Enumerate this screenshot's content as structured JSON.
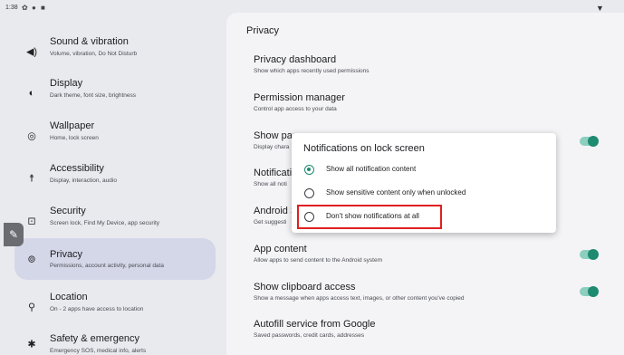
{
  "status_bar": {
    "time": "1:38",
    "icons": [
      "gear-icon",
      "circle-icon",
      "square-icon"
    ],
    "wifi": "wifi-icon"
  },
  "left_nav": {
    "items": [
      {
        "title": "Sound & vibration",
        "subtitle": "Volume, vibration, Do Not Disturb",
        "icon": "speaker-icon"
      },
      {
        "title": "Display",
        "subtitle": "Dark theme, font size, brightness",
        "icon": "brightness-icon"
      },
      {
        "title": "Wallpaper",
        "subtitle": "Home, lock screen",
        "icon": "palette-icon"
      },
      {
        "title": "Accessibility",
        "subtitle": "Display, interaction, audio",
        "icon": "accessibility-icon"
      },
      {
        "title": "Security",
        "subtitle": "Screen lock, Find My Device, app security",
        "icon": "lock-icon"
      },
      {
        "title": "Privacy",
        "subtitle": "Permissions, account activity, personal data",
        "icon": "privacy-icon",
        "selected": true
      },
      {
        "title": "Location",
        "subtitle": "On - 2 apps have access to location",
        "icon": "location-icon"
      },
      {
        "title": "Safety & emergency",
        "subtitle": "Emergency SOS, medical info, alerts",
        "icon": "asterisk-icon"
      }
    ]
  },
  "privacy": {
    "title": "Privacy",
    "settings": [
      {
        "title": "Privacy dashboard",
        "subtitle": "Show which apps recently used permissions"
      },
      {
        "title": "Permission manager",
        "subtitle": "Control app access to your data"
      },
      {
        "title": "Show pas",
        "subtitle": "Display chara",
        "toggle": true
      },
      {
        "title": "Notificati",
        "subtitle": "Show all noti"
      },
      {
        "title": "Android S",
        "subtitle": "Get suggesti"
      },
      {
        "title": "App content",
        "subtitle": "Allow apps to send content to the Android system",
        "toggle": true
      },
      {
        "title": "Show clipboard access",
        "subtitle": "Show a message when apps access text, images, or other content you've copied",
        "toggle": true
      },
      {
        "title": "Autofill service from Google",
        "subtitle": "Saved passwords, credit cards, addresses"
      }
    ]
  },
  "dialog": {
    "title": "Notifications on lock screen",
    "options": [
      {
        "label": "Show all notification content",
        "checked": true
      },
      {
        "label": "Show sensitive content only when unlocked",
        "checked": false
      },
      {
        "label": "Don't show notifications at all",
        "checked": false
      }
    ]
  },
  "colors": {
    "accent": "#1e8a70",
    "highlight": "#e02020",
    "selected_nav": "#d4d7e8"
  }
}
